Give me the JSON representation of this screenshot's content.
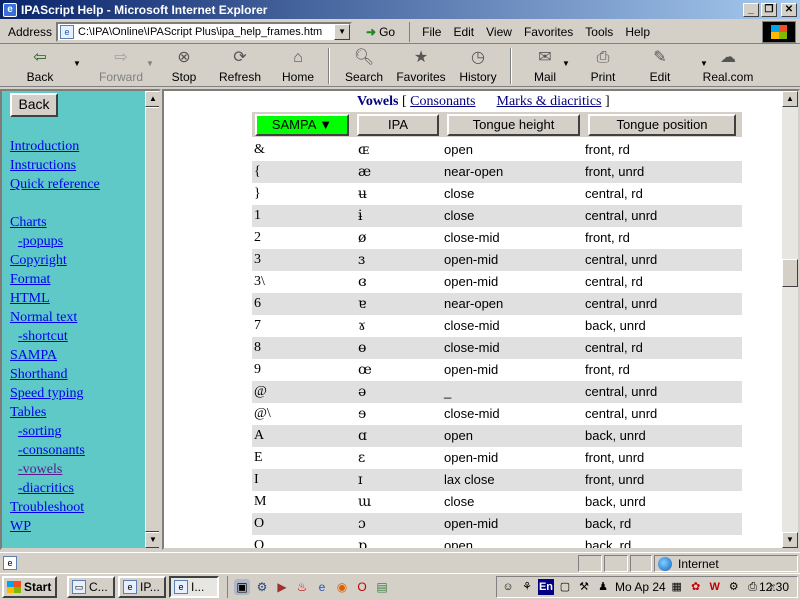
{
  "window": {
    "title": "IPAScript Help - Microsoft Internet Explorer"
  },
  "address": {
    "label": "Address",
    "value": "C:\\IPA\\Online\\IPAScript Plus\\ipa_help_frames.htm",
    "go_label": "Go"
  },
  "menu": [
    "File",
    "Edit",
    "View",
    "Favorites",
    "Tools",
    "Help"
  ],
  "toolbar": {
    "back": "Back",
    "forward": "Forward",
    "stop": "Stop",
    "refresh": "Refresh",
    "home": "Home",
    "search": "Search",
    "favorites": "Favorites",
    "history": "History",
    "mail": "Mail",
    "print": "Print",
    "edit": "Edit",
    "realcom": "Real.com"
  },
  "left": {
    "back_button": "Back",
    "links": {
      "introduction": "Introduction",
      "instructions": "Instructions",
      "quick_reference": "Quick reference",
      "charts": "Charts",
      "popups": "-popups",
      "copyright": "Copyright",
      "format": "Format",
      "html": "HTML",
      "normal_text": "Normal text",
      "shortcut": "-shortcut",
      "sampa": "SAMPA",
      "shorthand": "Shorthand",
      "speed_typing": "Speed typing",
      "tables": "Tables",
      "sorting": "-sorting",
      "consonants": "-consonants",
      "vowels": "-vowels",
      "diacritics": "-diacritics",
      "troubleshoot": "Troubleshoot",
      "wp": "WP"
    }
  },
  "main": {
    "nav": {
      "current": "Vowels",
      "open_bracket": "[",
      "consonants": "Consonants",
      "marks": "Marks & diacritics",
      "close_bracket": "]"
    },
    "columns": {
      "sampa": "SAMPA ▼",
      "ipa": "IPA",
      "height": "Tongue height",
      "position": "Tongue position"
    },
    "rows": [
      {
        "sampa": "&",
        "ipa": "ɶ",
        "height": "open",
        "position": "front, rd"
      },
      {
        "sampa": "{",
        "ipa": "æ",
        "height": "near-open",
        "position": "front, unrd"
      },
      {
        "sampa": "}",
        "ipa": "ʉ",
        "height": "close",
        "position": "central, rd"
      },
      {
        "sampa": "1",
        "ipa": "ɨ",
        "height": "close",
        "position": "central, unrd"
      },
      {
        "sampa": "2",
        "ipa": "ø",
        "height": "close-mid",
        "position": "front, rd"
      },
      {
        "sampa": "3",
        "ipa": "ɜ",
        "height": "open-mid",
        "position": "central, unrd"
      },
      {
        "sampa": "3\\",
        "ipa": "ɞ",
        "height": "open-mid",
        "position": "central, rd"
      },
      {
        "sampa": "6",
        "ipa": "ɐ",
        "height": "near-open",
        "position": "central, unrd"
      },
      {
        "sampa": "7",
        "ipa": "ɤ",
        "height": "close-mid",
        "position": "back, unrd"
      },
      {
        "sampa": "8",
        "ipa": "ɵ",
        "height": "close-mid",
        "position": "central, rd"
      },
      {
        "sampa": "9",
        "ipa": "œ",
        "height": "open-mid",
        "position": "front, rd"
      },
      {
        "sampa": "@",
        "ipa": "ə",
        "height": "_",
        "position": "central, unrd"
      },
      {
        "sampa": "@\\",
        "ipa": "ɘ",
        "height": "close-mid",
        "position": "central, unrd"
      },
      {
        "sampa": "A",
        "ipa": "ɑ",
        "height": "open",
        "position": "back, unrd"
      },
      {
        "sampa": "E",
        "ipa": "ɛ",
        "height": "open-mid",
        "position": "front, unrd"
      },
      {
        "sampa": "I",
        "ipa": "ɪ",
        "height": "lax close",
        "position": "front, unrd"
      },
      {
        "sampa": "M",
        "ipa": "ɯ",
        "height": "close",
        "position": "back, unrd"
      },
      {
        "sampa": "O",
        "ipa": "ɔ",
        "height": "open-mid",
        "position": "back, rd"
      },
      {
        "sampa": "Q",
        "ipa": "ɒ",
        "height": "open",
        "position": "back, rd"
      }
    ]
  },
  "status": {
    "zone": "Internet"
  },
  "taskbar": {
    "start": "Start",
    "tasks": [
      "C...",
      "IP...",
      "I..."
    ],
    "lang": "En",
    "date": "Mo Ap 24",
    "clock": "12:30"
  }
}
